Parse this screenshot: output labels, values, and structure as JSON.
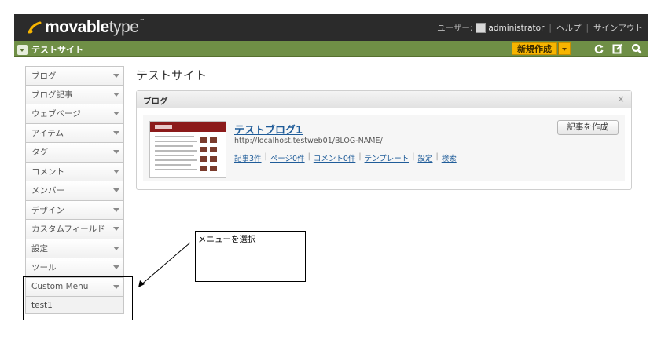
{
  "header": {
    "logo_bold": "movable",
    "logo_thin": "type",
    "logo_tm": "™",
    "user_label": "ユーザー:",
    "username": "administrator",
    "help": "ヘルプ",
    "signout": "サインアウト"
  },
  "sitebar": {
    "site_name": "テストサイト",
    "new_label": "新規作成",
    "icons": [
      "refresh-icon",
      "edit-icon",
      "search-icon"
    ]
  },
  "sidebar": {
    "items": [
      {
        "label": "ブログ"
      },
      {
        "label": "ブログ記事"
      },
      {
        "label": "ウェブページ"
      },
      {
        "label": "アイテム"
      },
      {
        "label": "タグ"
      },
      {
        "label": "コメント"
      },
      {
        "label": "メンバー"
      },
      {
        "label": "デザイン"
      },
      {
        "label": "カスタムフィールド"
      },
      {
        "label": "設定"
      },
      {
        "label": "ツール"
      },
      {
        "label": "Custom Menu"
      }
    ],
    "submenu": "test1"
  },
  "main": {
    "page_title": "テストサイト",
    "widget_title": "ブログ",
    "close_glyph": "×",
    "blog": {
      "name": "テストブログ1",
      "url": "http://localhost.testweb01/BLOG-NAME/",
      "links": [
        "記事3件",
        "ページ0件",
        "コメント0件",
        "テンプレート",
        "設定",
        "検索"
      ],
      "write_button": "記事を作成"
    }
  },
  "annotation": {
    "text": "メニューを選択"
  },
  "colors": {
    "topbar": "#2b2b2b",
    "sitebar": "#6f8f46",
    "new_button": "#f7b500",
    "link": "#1f5c99"
  }
}
